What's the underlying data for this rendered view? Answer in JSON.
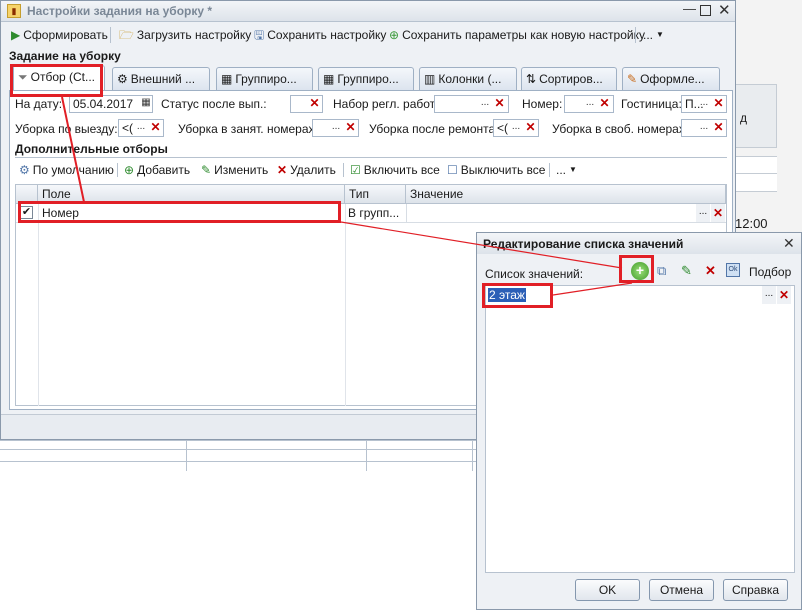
{
  "main_window": {
    "title": "Настройки задания на уборку *",
    "toolbar": {
      "generate": "Сформировать",
      "load": "Загрузить настройку",
      "save": "Сохранить настройку",
      "save_new": "Сохранить параметры как новую настройку",
      "more": "..."
    },
    "section_title": "Задание на уборку",
    "tabs": [
      "Отбор (Ct...",
      "Внешний ...",
      "Группиро...",
      "Группиро...",
      "Колонки (...",
      "Сортиров...",
      "Оформле..."
    ],
    "filters": {
      "date_label": "На дату:",
      "date_value": "05.04.2017",
      "status_label": "Статус после вып.:",
      "set_label": "Набор регл. работ:",
      "number_label": "Номер:",
      "hotel_label": "Гостиница:",
      "hotel_value": "П...",
      "departure_label": "Уборка по выезду:",
      "departure_value": "<(",
      "occupied_label": "Уборка в занят. номерах:",
      "repair_label": "Уборка после ремонта:",
      "repair_value": "<(",
      "free_label": "Уборка в своб. номерах:"
    },
    "additional_title": "Дополнительные отборы",
    "filters_toolbar": {
      "default": "По умолчанию",
      "add": "Добавить",
      "edit": "Изменить",
      "delete": "Удалить",
      "enable_all": "Включить все",
      "disable_all": "Выключить все",
      "more": "..."
    },
    "table": {
      "columns": [
        "Поле",
        "Тип сра...",
        "Значение"
      ],
      "rows": [
        {
          "field": "Номер",
          "type": "В групп...",
          "value": ""
        }
      ]
    }
  },
  "background": {
    "col_label": "д",
    "time": "12:00"
  },
  "dialog": {
    "title": "Редактирование списка значений",
    "list_label": "Список значений:",
    "pick_label": "Подбор",
    "value": "2 этаж",
    "ok": "OK",
    "cancel": "Отмена",
    "help": "Справка"
  }
}
